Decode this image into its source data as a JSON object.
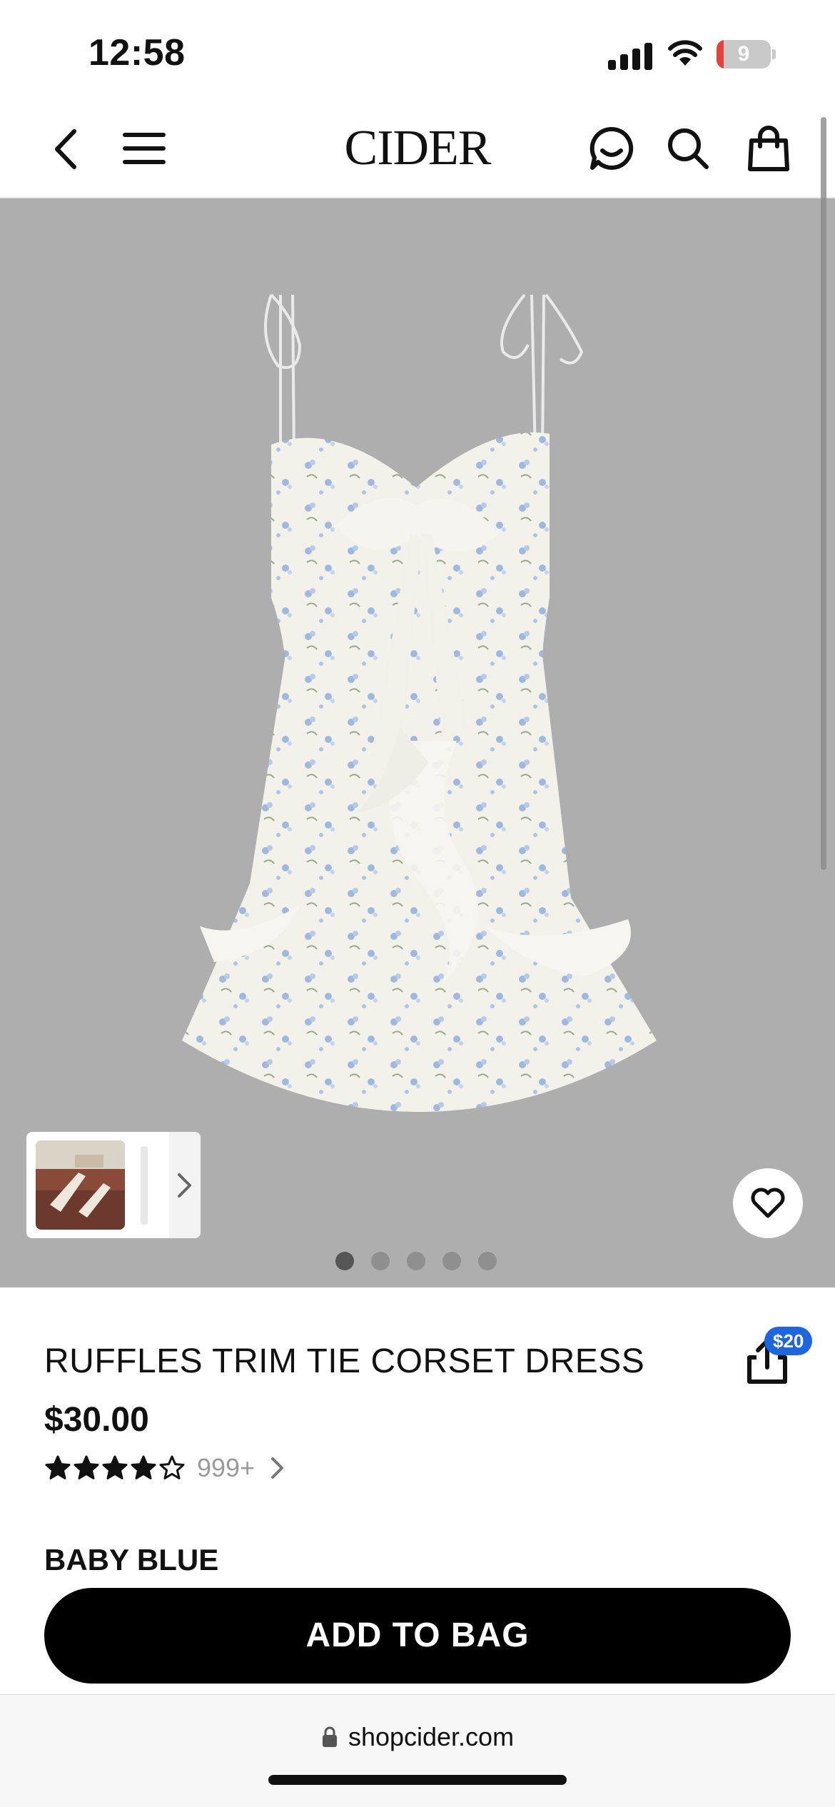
{
  "status_bar": {
    "time": "12:58",
    "battery_level": "9",
    "icons": [
      "signal-icon",
      "wifi-icon",
      "battery-icon"
    ]
  },
  "nav": {
    "logo": "CIDER",
    "icons": [
      "back-arrow-icon",
      "menu-icon",
      "chat-icon",
      "search-icon",
      "shopping-bag-icon"
    ]
  },
  "gallery": {
    "image_count": 5,
    "active_index": 0,
    "thumbnail_icon": "chevron-right-icon",
    "favorite_icon": "heart-icon"
  },
  "product": {
    "title": "RUFFLES TRIM TIE CORSET DRESS",
    "price": "$30.00",
    "rating_stars": 4,
    "rating_max": 5,
    "review_count": "999+",
    "share_badge": "$20",
    "color_label": "BABY BLUE"
  },
  "actions": {
    "add_to_bag_label": "ADD TO BAG"
  },
  "browser": {
    "url": "shopcider.com"
  },
  "colors": {
    "hero_bg": "#aeaeae",
    "badge_blue": "#1d66e0",
    "cta_bg": "#000000",
    "battery_red": "#e3433a"
  }
}
